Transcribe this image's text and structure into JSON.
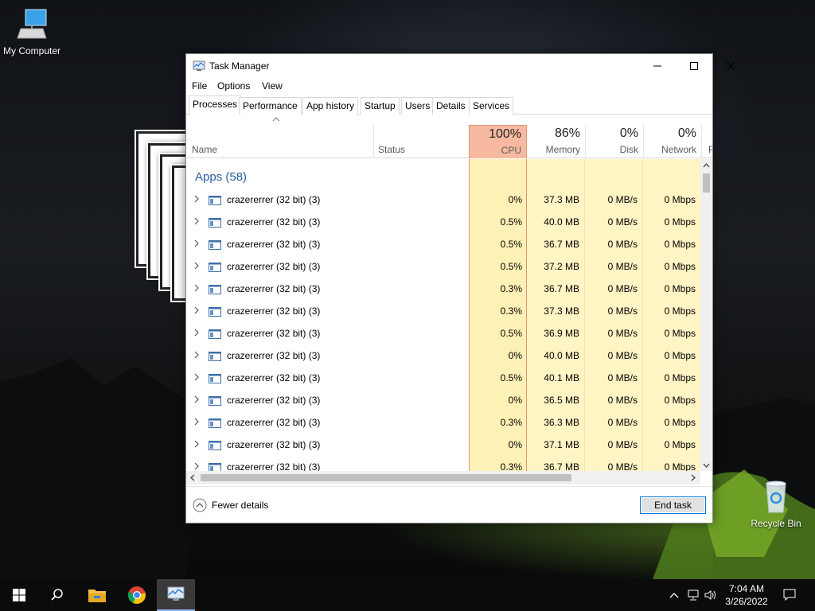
{
  "desktop": {
    "icons": [
      {
        "label": "My Computer",
        "icon": "computer-icon"
      },
      {
        "label": "Recycle Bin",
        "icon": "recycle-bin-icon"
      }
    ]
  },
  "window": {
    "title": "Task Manager",
    "menu": [
      "File",
      "Options",
      "View"
    ],
    "tabs": [
      "Processes",
      "Performance",
      "App history",
      "Startup",
      "Users",
      "Details",
      "Services"
    ],
    "active_tab": "Processes",
    "columns": {
      "name": "Name",
      "status": "Status",
      "cpu": {
        "percent": "100%",
        "label": "CPU"
      },
      "memory": {
        "percent": "86%",
        "label": "Memory"
      },
      "disk": {
        "percent": "0%",
        "label": "Disk"
      },
      "network": {
        "percent": "0%",
        "label": "Network"
      },
      "power": "P"
    },
    "group_title": "Apps (58)",
    "rows": [
      {
        "name": "crazererrer (32 bit) (3)",
        "cpu": "0%",
        "memory": "37.3 MB",
        "disk": "0 MB/s",
        "network": "0 Mbps"
      },
      {
        "name": "crazererrer (32 bit) (3)",
        "cpu": "0.5%",
        "memory": "40.0 MB",
        "disk": "0 MB/s",
        "network": "0 Mbps"
      },
      {
        "name": "crazererrer (32 bit) (3)",
        "cpu": "0.5%",
        "memory": "36.7 MB",
        "disk": "0 MB/s",
        "network": "0 Mbps"
      },
      {
        "name": "crazererrer (32 bit) (3)",
        "cpu": "0.5%",
        "memory": "37.2 MB",
        "disk": "0 MB/s",
        "network": "0 Mbps"
      },
      {
        "name": "crazererrer (32 bit) (3)",
        "cpu": "0.3%",
        "memory": "36.7 MB",
        "disk": "0 MB/s",
        "network": "0 Mbps"
      },
      {
        "name": "crazererrer (32 bit) (3)",
        "cpu": "0.3%",
        "memory": "37.3 MB",
        "disk": "0 MB/s",
        "network": "0 Mbps"
      },
      {
        "name": "crazererrer (32 bit) (3)",
        "cpu": "0.5%",
        "memory": "36.9 MB",
        "disk": "0 MB/s",
        "network": "0 Mbps"
      },
      {
        "name": "crazererrer (32 bit) (3)",
        "cpu": "0%",
        "memory": "40.0 MB",
        "disk": "0 MB/s",
        "network": "0 Mbps"
      },
      {
        "name": "crazererrer (32 bit) (3)",
        "cpu": "0.5%",
        "memory": "40.1 MB",
        "disk": "0 MB/s",
        "network": "0 Mbps"
      },
      {
        "name": "crazererrer (32 bit) (3)",
        "cpu": "0%",
        "memory": "36.5 MB",
        "disk": "0 MB/s",
        "network": "0 Mbps"
      },
      {
        "name": "crazererrer (32 bit) (3)",
        "cpu": "0.3%",
        "memory": "36.3 MB",
        "disk": "0 MB/s",
        "network": "0 Mbps"
      },
      {
        "name": "crazererrer (32 bit) (3)",
        "cpu": "0%",
        "memory": "37.1 MB",
        "disk": "0 MB/s",
        "network": "0 Mbps"
      },
      {
        "name": "crazererrer (32 bit) (3)",
        "cpu": "0.3%",
        "memory": "36.7 MB",
        "disk": "0 MB/s",
        "network": "0 Mbps"
      }
    ],
    "footer": {
      "fewer_details": "Fewer details",
      "end_task": "End task"
    },
    "colors": {
      "cpu_header": "#f7b9a0",
      "cpu_cells": "#fdf1b6",
      "other_cells": "#fff8d6",
      "group_title": "#2b5fa0"
    }
  },
  "taskbar": {
    "items": [
      "start-icon",
      "search-icon",
      "file-explorer-icon",
      "chrome-icon",
      "task-manager-icon"
    ],
    "active_item": "task-manager-icon",
    "time": "7:04 AM",
    "date": "3/26/2022"
  }
}
